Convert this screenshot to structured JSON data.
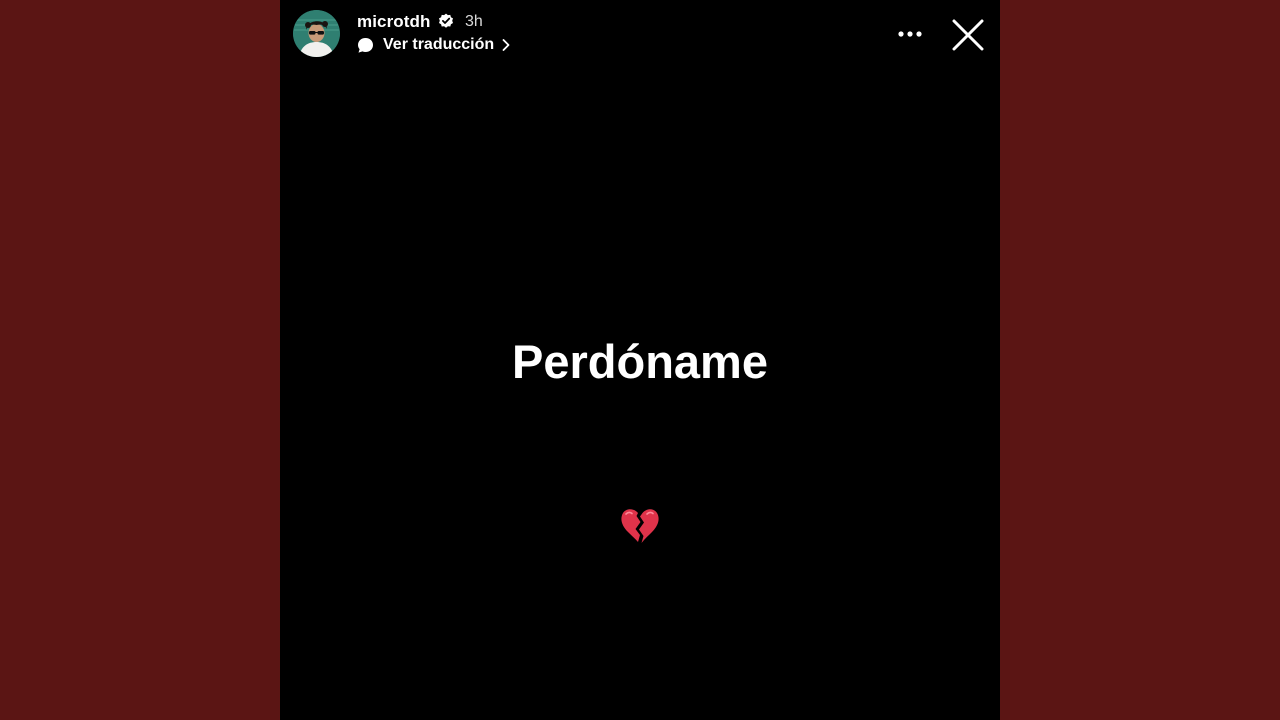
{
  "story": {
    "username": "microtdh",
    "time": "3h",
    "translate_label": "Ver traducción",
    "text": "Perdóname",
    "emoji_icon": "broken-heart-icon"
  },
  "icons": {
    "verified": "verified-badge-icon",
    "translate": "speech-bubble-icon",
    "chevron": "chevron-right-icon",
    "more": "more-dots-icon",
    "close": "close-icon"
  },
  "colors": {
    "backdrop": "#5b1514",
    "story_background": "#000000",
    "text": "#ffffff",
    "heart": "#e0334a"
  }
}
